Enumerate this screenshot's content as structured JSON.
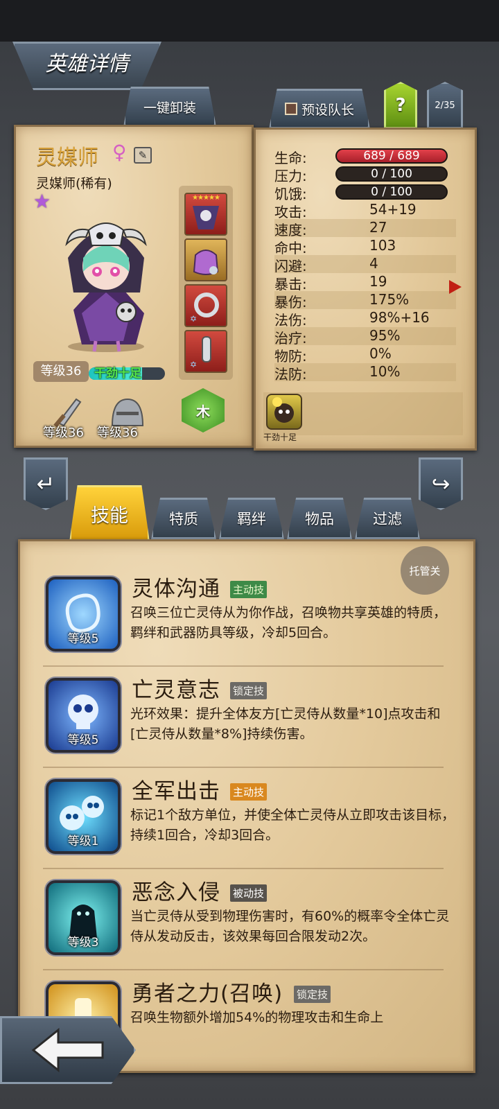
{
  "header": {
    "title": "英雄详情"
  },
  "top_buttons": {
    "unequip_all": "一键卸装",
    "preset_captain": "预设队长",
    "help": "?",
    "page_counter": "2/35"
  },
  "hero": {
    "name": "灵媒师",
    "class_rarity": "灵媒师(稀有)",
    "level_badge": "等级36",
    "trait_label": "干劲十足",
    "weapon_level": "等级36",
    "armor_level": "等级36",
    "element": "木",
    "buff_label": "干劲十足"
  },
  "stats": {
    "hp": {
      "label": "生命:",
      "value": "689 / 689"
    },
    "stress": {
      "label": "压力:",
      "value": "0 / 100"
    },
    "hunger": {
      "label": "饥饿:",
      "value": "0 / 100"
    },
    "rows": [
      {
        "label": "攻击:",
        "value": "54+19"
      },
      {
        "label": "速度:",
        "value": "27"
      },
      {
        "label": "命中:",
        "value": "103"
      },
      {
        "label": "闪避:",
        "value": "4"
      },
      {
        "label": "暴击:",
        "value": "19"
      },
      {
        "label": "暴伤:",
        "value": "175%"
      },
      {
        "label": "法伤:",
        "value": "98%+16"
      },
      {
        "label": "治疗:",
        "value": "95%"
      },
      {
        "label": "物防:",
        "value": "0%"
      },
      {
        "label": "法防:",
        "value": "10%"
      }
    ]
  },
  "tabs": [
    "技能",
    "特质",
    "羁绊",
    "物品",
    "过滤"
  ],
  "auto_toggle": "托管关",
  "skills": [
    {
      "name": "灵体沟通",
      "tag": "主动技",
      "level": "等级5",
      "desc": "召唤三位亡灵侍从为你作战，召唤物共享英雄的特质，羁绊和武器防具等级，冷却5回合。"
    },
    {
      "name": "亡灵意志",
      "tag": "锁定技",
      "level": "等级5",
      "desc": "光环效果：提升全体友方[亡灵侍从数量*10]点攻击和[亡灵侍从数量*8%]持续伤害。"
    },
    {
      "name": "全军出击",
      "tag": "主动技",
      "level": "等级1",
      "desc": "标记1个敌方单位，并使全体亡灵侍从立即攻击该目标，持续1回合，冷却3回合。"
    },
    {
      "name": "恶念入侵",
      "tag": "被动技",
      "level": "等级3",
      "desc": "当亡灵侍从受到物理伤害时，有60%的概率令全体亡灵侍从发动反击，该效果每回合限发动2次。"
    },
    {
      "name": "勇者之力(召唤)",
      "tag": "锁定技",
      "level": "",
      "desc": "召唤生物额外增加54%的物理攻击和生命上"
    }
  ]
}
